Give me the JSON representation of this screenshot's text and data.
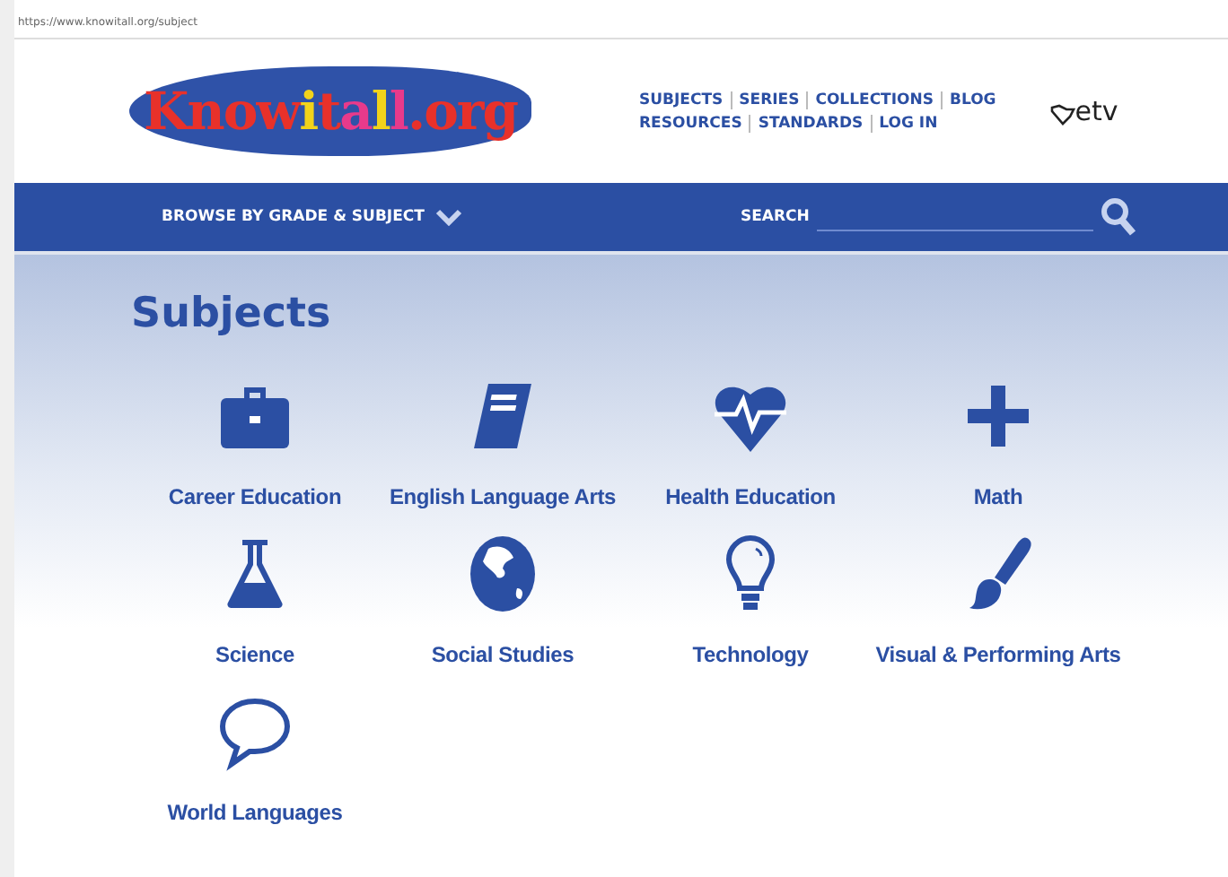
{
  "address_bar": {
    "url": "https://www.knowitall.org/subject"
  },
  "header": {
    "logo": "Knowitall.org",
    "nav_rows": [
      [
        "SUBJECTS",
        "SERIES",
        "COLLECTIONS",
        "BLOG"
      ],
      [
        "RESOURCES",
        "STANDARDS",
        "LOG IN"
      ]
    ],
    "partner_logo": "etv"
  },
  "nav_bar": {
    "browse": "BROWSE BY GRADE & SUBJECT",
    "search_label": "SEARCH"
  },
  "heading": "Subjects",
  "subjects": [
    "Career Education",
    "English Language Arts",
    "Health Education",
    "Math",
    "Science",
    "Social Studies",
    "Technology",
    "Visual & Performing Arts",
    "World Languages"
  ]
}
